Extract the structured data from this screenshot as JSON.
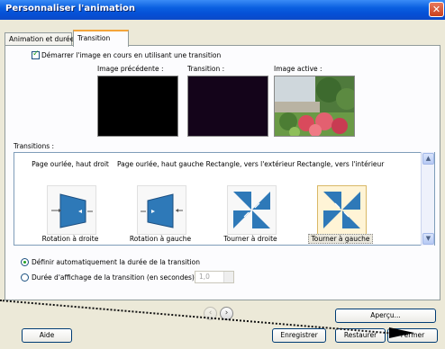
{
  "window": {
    "title": "Personnaliser l'animation"
  },
  "tabs": [
    "Animation et durée",
    "Transition"
  ],
  "start_checkbox": {
    "label": "Démarrer l'image en cours en utilisant une transition",
    "checked": true
  },
  "previews": {
    "previous_label": "Image précédente :",
    "transition_label": "Transition :",
    "active_label": "Image active :"
  },
  "transitions": {
    "label": "Transitions :",
    "items": [
      {
        "title": "Page ourlée, haut droit",
        "caption": "Rotation à droite",
        "icon": "page-curl-right-icon"
      },
      {
        "title": "Page ourlée, haut gauche",
        "caption": "Rotation à gauche",
        "icon": "page-curl-left-icon"
      },
      {
        "title": "Rectangle, vers l'extérieur",
        "caption": "Tourner à droite",
        "icon": "pinwheel-right-icon"
      },
      {
        "title": "Rectangle, vers l'intérieur",
        "caption": "Tourner à gauche",
        "icon": "pinwheel-left-icon",
        "selected": true
      }
    ]
  },
  "duration": {
    "auto_label": "Définir automatiquement la durée de la transition",
    "manual_label": "Durée d'affichage de la transition (en secondes)",
    "value": "1,0",
    "selected": "auto"
  },
  "buttons": {
    "preview": "Aperçu...",
    "help": "Aide",
    "save": "Enregistrer",
    "restore": "Restaurer",
    "close": "Fermer"
  },
  "colors": {
    "title_bar": "#0a5fe0",
    "dialog_bg": "#ece9d8",
    "check_mark": "#21a121",
    "tab_highlight": "#f4a53a"
  }
}
